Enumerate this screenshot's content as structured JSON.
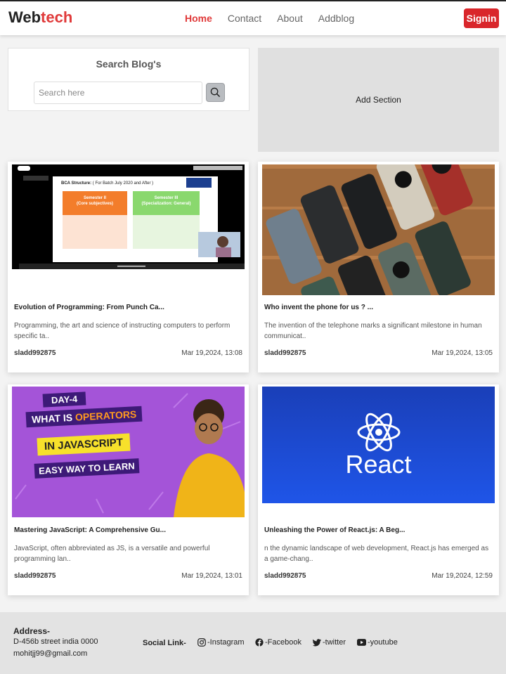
{
  "brand": {
    "part1": "Web",
    "part2": "tech"
  },
  "nav": {
    "home": "Home",
    "contact": "Contact",
    "about": "About",
    "addblog": "Addblog",
    "signin": "Signin"
  },
  "search": {
    "title": "Search Blog's",
    "placeholder": "Search here"
  },
  "add_section": "Add Section",
  "posts": [
    {
      "title": "Evolution of Programming: From Punch Ca...",
      "desc": "Programming, the art and science of instructing computers to perform specific ta..",
      "author": "sladd992875",
      "date": "Mar 19,2024, 13:08",
      "thumb": {
        "header": "BCA Structure:",
        "sub": "( For Batch July 2020 and After )",
        "sem2": "Semester II",
        "sem2_sub": "(Core subjectives)",
        "sem3": "Semester III",
        "sem3_sub": "(Specialization: General)"
      }
    },
    {
      "title": "Who invent the phone for us ? ...",
      "desc": "The invention of the telephone marks a significant milestone in human communicat..",
      "author": "sladd992875",
      "date": "Mar 19,2024, 13:05"
    },
    {
      "title": "Mastering JavaScript: A Comprehensive Gu...",
      "desc": "JavaScript, often abbreviated as JS, is a versatile and powerful programming lan..",
      "author": "sladd992875",
      "date": "Mar 19,2024, 13:01",
      "thumb": {
        "day": "DAY-4",
        "line1a": "WHAT IS ",
        "line1b": "OPERATORS",
        "line2": "IN JAVASCRIPT",
        "line3": "EASY WAY TO LEARN"
      }
    },
    {
      "title": "Unleashing the Power of React.js: A Beg...",
      "desc": "n the dynamic landscape of web development, React.js has emerged as a game-chang..",
      "author": "sladd992875",
      "date": "Mar 19,2024, 12:59",
      "thumb": {
        "word": "React"
      }
    }
  ],
  "footer": {
    "address_label": "Address-",
    "address_line": "D-456b street india 0000",
    "email": "mohitjj99@gmail.com",
    "social_label": "Social Link-",
    "instagram": "-Instagram",
    "facebook": "-Facebook",
    "twitter": "-twitter",
    "youtube": "-youtube"
  },
  "colors": {
    "accent": "#e03a3a",
    "signin": "#d9262b",
    "react_blue": "#1b49e0",
    "js_purple": "#a454d8"
  },
  "icons": [
    "search-icon",
    "instagram-icon",
    "facebook-icon",
    "twitter-icon",
    "youtube-icon"
  ]
}
